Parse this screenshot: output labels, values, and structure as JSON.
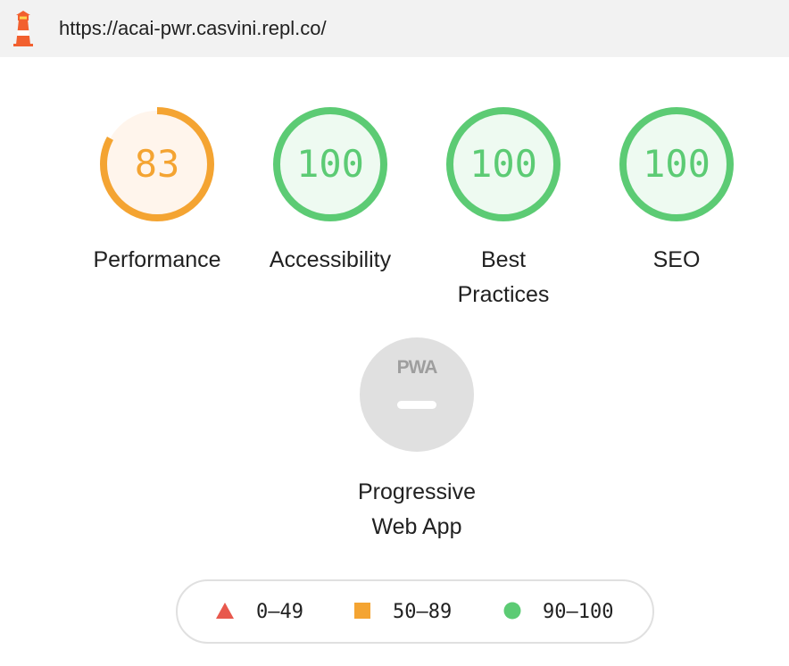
{
  "header": {
    "url": "https://acai-pwr.casvini.repl.co/",
    "logo_icon": "lighthouse-icon"
  },
  "gauges": [
    {
      "label": "Performance",
      "score": "83",
      "value": 83,
      "color": "#f4a432",
      "fill": "#fff5ec"
    },
    {
      "label": "Accessibility",
      "score": "100",
      "value": 100,
      "color": "#5ccb74",
      "fill": "#eefaf1"
    },
    {
      "label_line1": "Best",
      "label_line2": "Practices",
      "score": "100",
      "value": 100,
      "color": "#5ccb74",
      "fill": "#eefaf1"
    },
    {
      "label": "SEO",
      "score": "100",
      "value": 100,
      "color": "#5ccb74",
      "fill": "#eefaf1"
    }
  ],
  "pwa": {
    "badge_text": "PWA",
    "label_line1": "Progressive",
    "label_line2": "Web App",
    "color": "#e0e0e0"
  },
  "legend": [
    {
      "range": "0–49",
      "shape": "triangle",
      "color": "#e8584d"
    },
    {
      "range": "50–89",
      "shape": "square",
      "color": "#f4a432"
    },
    {
      "range": "90–100",
      "shape": "circle",
      "color": "#5ccb74"
    }
  ]
}
